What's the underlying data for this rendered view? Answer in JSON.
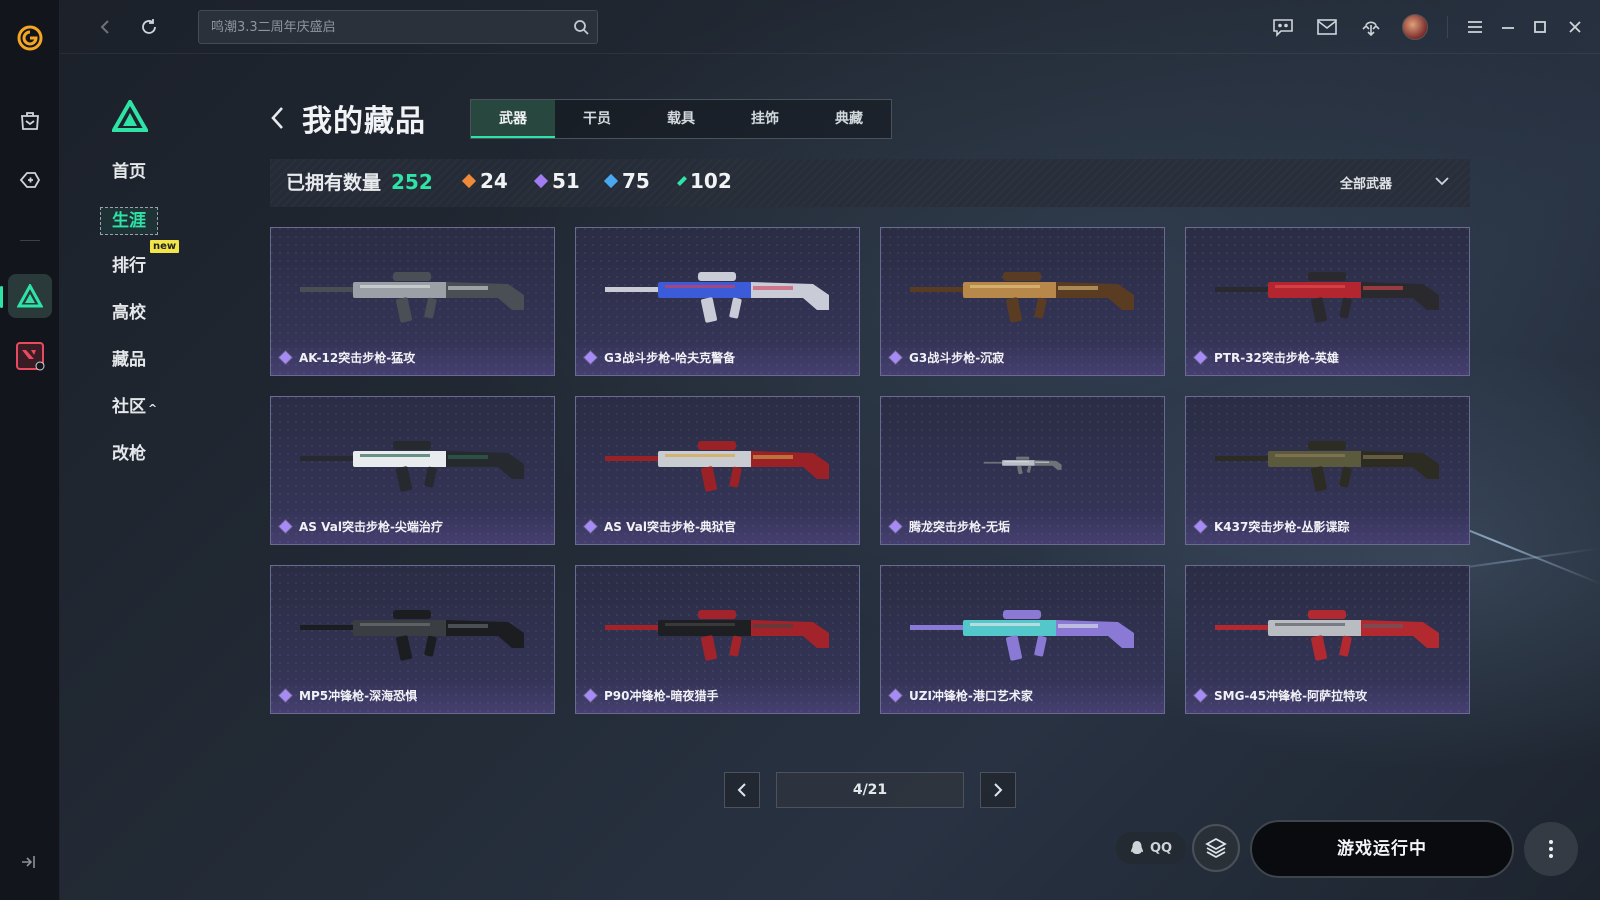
{
  "topbar": {
    "search_placeholder": "鸣潮3.3二周年庆盛启"
  },
  "sidebar": {
    "items": [
      {
        "label": "首页"
      },
      {
        "label": "生涯"
      },
      {
        "label": "排行"
      },
      {
        "label": "高校"
      },
      {
        "label": "藏品"
      },
      {
        "label": "社区"
      },
      {
        "label": "改枪"
      }
    ],
    "new_badge": "new",
    "community_caret": "^"
  },
  "main": {
    "title": "我的藏品",
    "tabs": [
      {
        "label": "武器",
        "active": true
      },
      {
        "label": "干员",
        "active": false
      },
      {
        "label": "载具",
        "active": false
      },
      {
        "label": "挂饰",
        "active": false
      },
      {
        "label": "典藏",
        "active": false
      }
    ],
    "stats": {
      "owned_label": "已拥有数量",
      "owned_count": "252",
      "rarities": [
        {
          "count": "24",
          "color": "#f08a3a"
        },
        {
          "count": "51",
          "color": "#a27cf2"
        },
        {
          "count": "75",
          "color": "#4aa8f0"
        },
        {
          "count": "102",
          "color": "#2fe3a6"
        }
      ],
      "filter_label": "全部武器"
    },
    "cards": [
      {
        "name": "AK-12突击步枪-猛攻",
        "palette": "grey"
      },
      {
        "name": "G3战斗步枪-哈夫克警备",
        "palette": "blue"
      },
      {
        "name": "G3战斗步枪-沉寂",
        "palette": "brass"
      },
      {
        "name": "PTR-32突击步枪-英雄",
        "palette": "red"
      },
      {
        "name": "AS Val突击步枪-尖端治疗",
        "palette": "white"
      },
      {
        "name": "AS Val突击步枪-典狱官",
        "palette": "crimson"
      },
      {
        "name": "腾龙突击步枪-无垢",
        "palette": "silver"
      },
      {
        "name": "K437突击步枪-丛影谍踪",
        "palette": "camo"
      },
      {
        "name": "MP5冲锋枪-深海恐惧",
        "palette": "dark"
      },
      {
        "name": "P90冲锋枪-暗夜猎手",
        "palette": "black"
      },
      {
        "name": "UZI冲锋枪-港口艺术家",
        "palette": "teal"
      },
      {
        "name": "SMG-45冲锋枪-阿萨拉特攻",
        "palette": "redgrey"
      }
    ],
    "pagination": "4/21"
  },
  "bottom": {
    "qq_label": "QQ",
    "launch_label": "游戏运行中"
  },
  "colors": {
    "accent": "#2fe3a6",
    "card_border": "#6a6a92",
    "rarity_purple": "#a78bf5"
  }
}
